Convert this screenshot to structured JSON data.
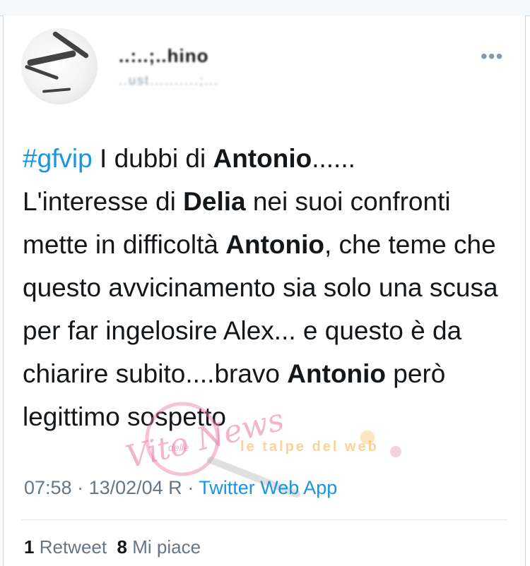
{
  "header": {
    "name": "..:..;..hino",
    "handle": "..ust..........;..."
  },
  "tweet": {
    "segments": [
      {
        "text": "#gfvip",
        "style": "hashtag"
      },
      {
        "text": " I dubbi di ",
        "style": "plain"
      },
      {
        "text": "Antonio",
        "style": "bold"
      },
      {
        "text": "......",
        "style": "plain"
      },
      {
        "text": " L'interesse di ",
        "style": "plain"
      },
      {
        "text": "Delia",
        "style": "bold"
      },
      {
        "text": " nei suoi confronti mette in difficoltà ",
        "style": "plain"
      },
      {
        "text": "Antonio",
        "style": "bold"
      },
      {
        "text": ", che teme che questo avvicinamento sia solo una scusa per far ingelosire Alex... e questo è da chiarire subito....bravo ",
        "style": "plain"
      },
      {
        "text": "Antonio",
        "style": "bold"
      },
      {
        "text": " però legittimo sospetto",
        "style": "plain"
      }
    ]
  },
  "meta": {
    "time": "07:58",
    "separator": " · ",
    "date": "13/02/04 R",
    "source": "Twitter Web App"
  },
  "stats": {
    "retweets_count": "1",
    "retweets_label": "Retweet",
    "likes_count": "8",
    "likes_label": "Mi piace"
  },
  "watermark": {
    "script": "Vito News",
    "small": "delle",
    "brand": "le talpe del web"
  },
  "colors": {
    "hashtag": "#1b95e0",
    "link": "#1b95e0",
    "muted": "#657786",
    "text": "#14171a",
    "watermark_pink": "#e97aa6",
    "watermark_gold": "#f4b24c"
  },
  "icons": {
    "more": "more-horizontal-icon"
  }
}
